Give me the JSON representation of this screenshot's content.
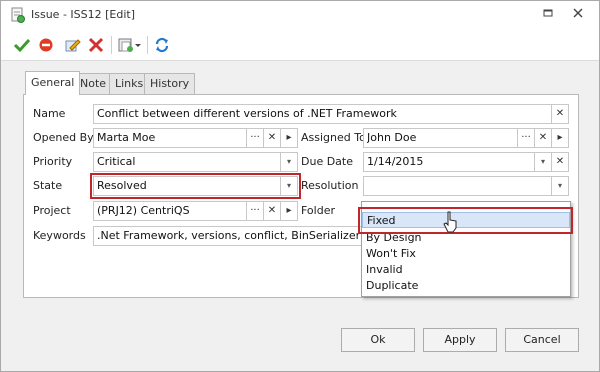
{
  "window": {
    "title": "Issue - ISS12 [Edit]"
  },
  "toolbar": {
    "buttons": [
      "save-close",
      "cancel",
      "edit",
      "delete",
      "new-dropdown",
      "refresh"
    ]
  },
  "tabs": [
    "General",
    "Note",
    "Links",
    "History"
  ],
  "form": {
    "name_label": "Name",
    "name_value": "Conflict between different versions of .NET Framework",
    "opened_by_label": "Opened By",
    "opened_by_value": "Marta Moe",
    "assigned_to_label": "Assigned To",
    "assigned_to_value": "John Doe",
    "priority_label": "Priority",
    "priority_value": "Critical",
    "due_date_label": "Due Date",
    "due_date_value": "1/14/2015",
    "state_label": "State",
    "state_value": "Resolved",
    "resolution_label": "Resolution",
    "resolution_value": "",
    "project_label": "Project",
    "project_value": "(PRJ12) CentriQS",
    "folder_label": "Folder",
    "keywords_label": "Keywords",
    "keywords_value": ".Net Framework, versions, conflict, BinSerializer, Unhan"
  },
  "resolution_options": [
    "Fixed",
    "By Design",
    "Won't Fix",
    "Invalid",
    "Duplicate"
  ],
  "buttons": {
    "ok": "Ok",
    "apply": "Apply",
    "cancel": "Cancel"
  },
  "glyphs": {
    "ellipsis": "···",
    "clear": "✕",
    "arrow": "▸",
    "dropdown": "▾"
  },
  "colors": {
    "highlight": "#c0272d",
    "hover": "#d8e6f7"
  }
}
